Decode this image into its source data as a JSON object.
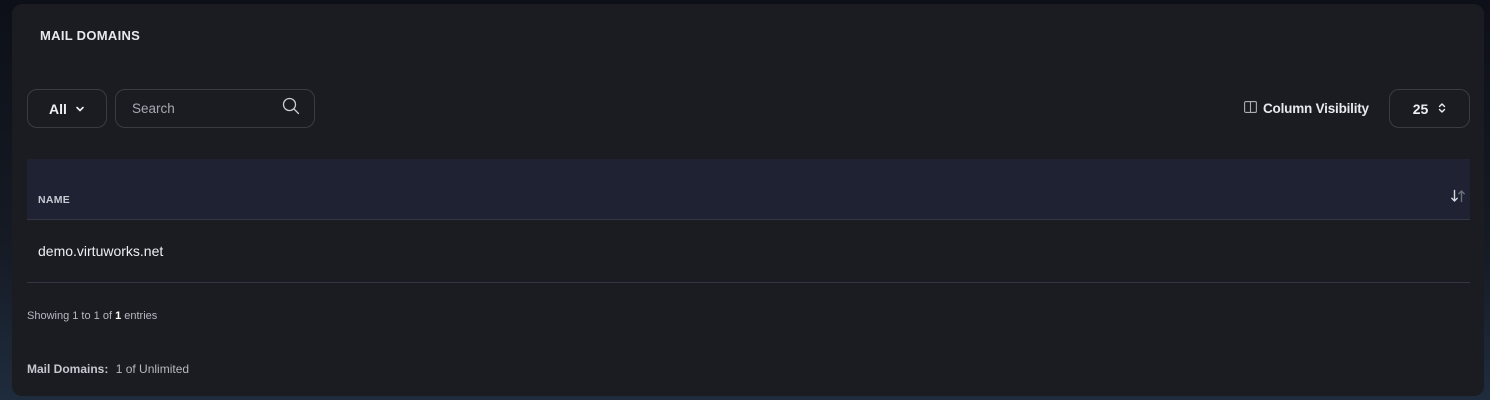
{
  "card": {
    "title": "MAIL DOMAINS"
  },
  "toolbar": {
    "filter_label": "All",
    "search_placeholder": "Search",
    "column_visibility_label": "Column Visibility",
    "page_size": "25"
  },
  "table": {
    "columns": [
      "NAME"
    ],
    "rows": [
      {
        "name": "demo.virtuworks.net"
      }
    ]
  },
  "footer": {
    "showing_prefix": "Showing 1 to 1 of",
    "showing_total": "1",
    "showing_suffix": "entries",
    "quota_label": "Mail Domains:",
    "quota_value": "1 of Unlimited"
  },
  "icons": {
    "filter_dropdown": "chevron-down-icon",
    "search": "search-icon",
    "column_visibility": "columns-icon",
    "page_size": "chevron-updown-icon",
    "sort": "sort-arrows-icon"
  },
  "colors": {
    "page_background": "#0d1018",
    "card_background": "#1b1c21",
    "table_header_background": "#1e2232",
    "border": "#3a3c45",
    "text": "#eef0f4",
    "muted_text": "#b5b8c1"
  }
}
